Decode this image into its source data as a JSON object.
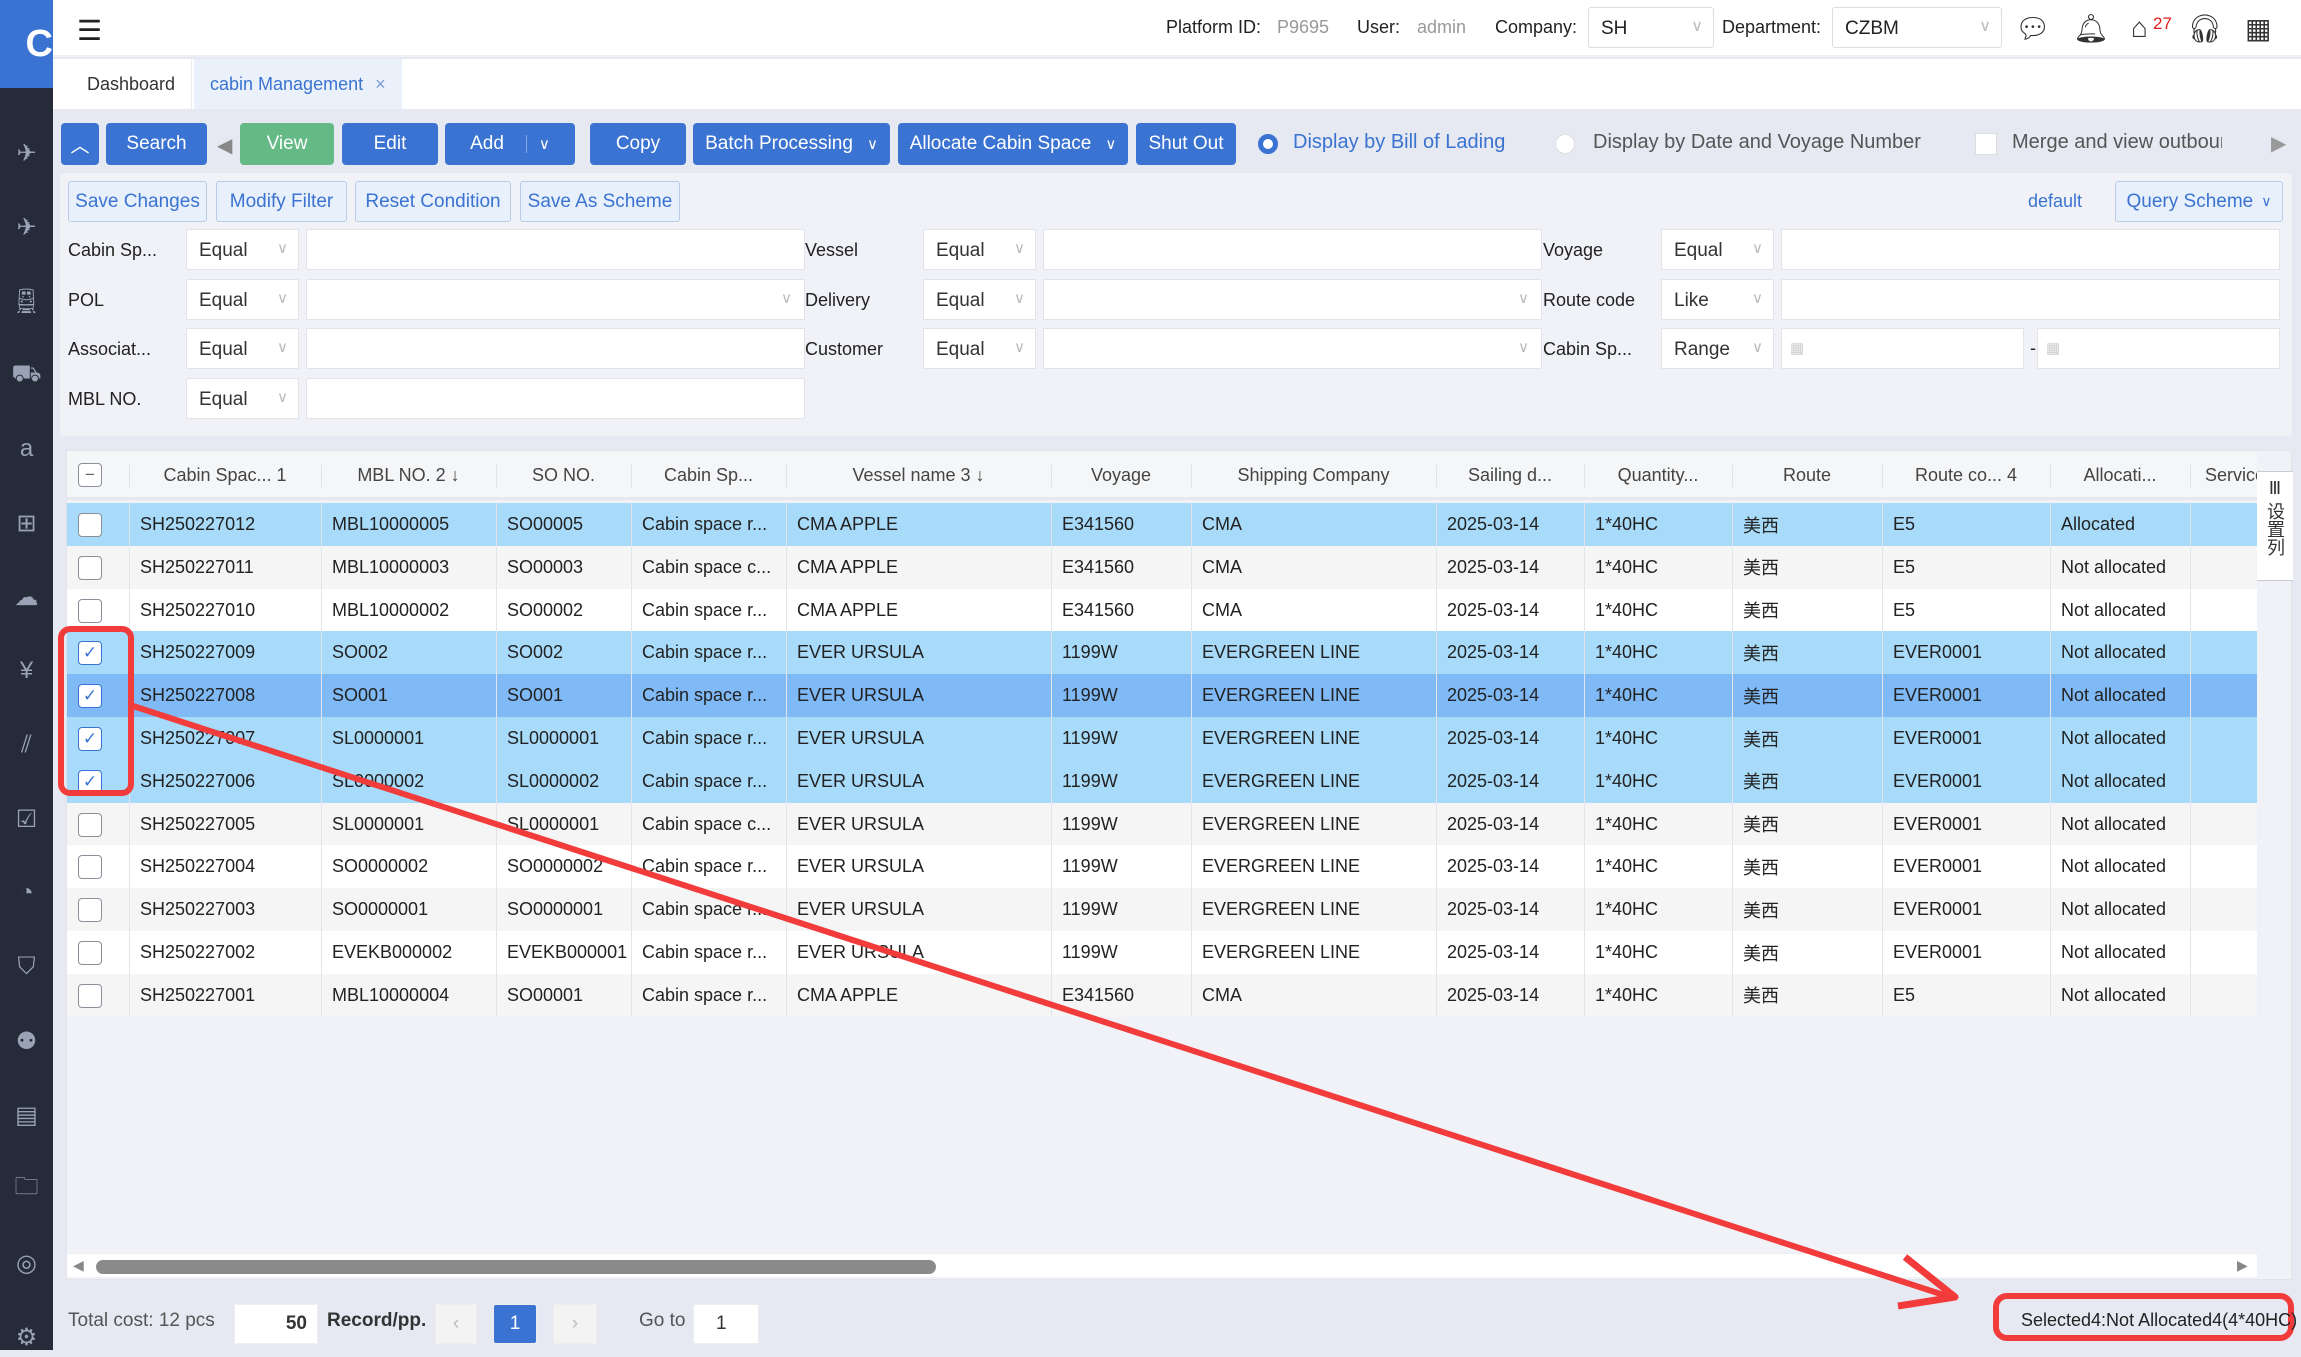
{
  "sidebar": {
    "logo": "C",
    "icons": [
      "flight-export-icon",
      "flight-import-icon",
      "rail-icon",
      "truck-icon",
      "amazon-icon",
      "calculator-icon",
      "cloud-upload-icon",
      "finance-icon",
      "chart-icon",
      "checklist-icon",
      "pie-chart-icon",
      "shield-icon",
      "robot-icon",
      "report-icon",
      "folder-icon",
      "webcam-icon",
      "settings-icon"
    ]
  },
  "header": {
    "platform_label": "Platform ID:",
    "platform_id": "P9695",
    "user_label": "User:",
    "user": "admin",
    "company_label": "Company:",
    "company": "SH",
    "department_label": "Department:",
    "department": "CZBM",
    "notif_count": "27"
  },
  "tabs": [
    {
      "label": "Dashboard"
    },
    {
      "label": "cabin Management",
      "close": "×"
    }
  ],
  "toolbar": {
    "search": "Search",
    "view": "View",
    "edit": "Edit",
    "add": "Add",
    "copy": "Copy",
    "batch": "Batch Processing",
    "allocate": "Allocate Cabin Space",
    "shutout": "Shut Out",
    "opt1": "Display by Bill of Lading",
    "opt2": "Display by Date and Voyage Number",
    "opt3": "Merge and view outbound b"
  },
  "filters": {
    "save_changes": "Save Changes",
    "modify_filter": "Modify Filter",
    "reset": "Reset Condition",
    "save_scheme": "Save As Scheme",
    "default": "default",
    "query_scheme": "Query Scheme",
    "fields": [
      {
        "label": "Cabin Sp...",
        "op": "Equal"
      },
      {
        "label": "Vessel",
        "op": "Equal"
      },
      {
        "label": "Voyage",
        "op": "Equal"
      },
      {
        "label": "POL",
        "op": "Equal"
      },
      {
        "label": "Delivery",
        "op": "Equal"
      },
      {
        "label": "Route code",
        "op": "Like"
      },
      {
        "label": "Associat...",
        "op": "Equal"
      },
      {
        "label": "Customer",
        "op": "Equal"
      },
      {
        "label": "Cabin Sp...",
        "op": "Range"
      },
      {
        "label": "MBL NO.",
        "op": "Equal"
      }
    ],
    "range_sep": "-"
  },
  "table": {
    "columns": [
      "Cabin Spac...  1",
      "MBL NO.  2 ↓",
      "SO NO.",
      "Cabin Sp...",
      "Vessel name  3 ↓",
      "Voyage",
      "Shipping Company",
      "Sailing d...",
      "Quantity...",
      "Route",
      "Route co...  4",
      "Allocati...",
      "Service"
    ],
    "column_settings": "设置列",
    "rows": [
      {
        "checked": false,
        "state": "sel",
        "cells": [
          "SH250227012",
          "MBL10000005",
          "SO00005",
          "Cabin space r...",
          "CMA APPLE",
          "E341560",
          "CMA",
          "2025-03-14",
          "1*40HC",
          "美西",
          "E5",
          "Allocated",
          ""
        ]
      },
      {
        "checked": false,
        "state": "odd",
        "cells": [
          "SH250227011",
          "MBL10000003",
          "SO00003",
          "Cabin space c...",
          "CMA APPLE",
          "E341560",
          "CMA",
          "2025-03-14",
          "1*40HC",
          "美西",
          "E5",
          "Not allocated",
          ""
        ]
      },
      {
        "checked": false,
        "state": "even",
        "cells": [
          "SH250227010",
          "MBL10000002",
          "SO00002",
          "Cabin space r...",
          "CMA APPLE",
          "E341560",
          "CMA",
          "2025-03-14",
          "1*40HC",
          "美西",
          "E5",
          "Not allocated",
          ""
        ]
      },
      {
        "checked": true,
        "state": "sel",
        "cells": [
          "SH250227009",
          "SO002",
          "SO002",
          "Cabin space r...",
          "EVER URSULA",
          "1199W",
          "EVERGREEN LINE",
          "2025-03-14",
          "1*40HC",
          "美西",
          "EVER0001",
          "Not allocated",
          ""
        ]
      },
      {
        "checked": true,
        "state": "cur",
        "cells": [
          "SH250227008",
          "SO001",
          "SO001",
          "Cabin space r...",
          "EVER URSULA",
          "1199W",
          "EVERGREEN LINE",
          "2025-03-14",
          "1*40HC",
          "美西",
          "EVER0001",
          "Not allocated",
          ""
        ]
      },
      {
        "checked": true,
        "state": "sel",
        "cells": [
          "SH250227007",
          "SL0000001",
          "SL0000001",
          "Cabin space r...",
          "EVER URSULA",
          "1199W",
          "EVERGREEN LINE",
          "2025-03-14",
          "1*40HC",
          "美西",
          "EVER0001",
          "Not allocated",
          ""
        ]
      },
      {
        "checked": true,
        "state": "sel",
        "cells": [
          "SH250227006",
          "SL0000002",
          "SL0000002",
          "Cabin space r...",
          "EVER URSULA",
          "1199W",
          "EVERGREEN LINE",
          "2025-03-14",
          "1*40HC",
          "美西",
          "EVER0001",
          "Not allocated",
          ""
        ]
      },
      {
        "checked": false,
        "state": "odd",
        "cells": [
          "SH250227005",
          "SL0000001",
          "SL0000001",
          "Cabin space c...",
          "EVER URSULA",
          "1199W",
          "EVERGREEN LINE",
          "2025-03-14",
          "1*40HC",
          "美西",
          "EVER0001",
          "Not allocated",
          ""
        ]
      },
      {
        "checked": false,
        "state": "even",
        "cells": [
          "SH250227004",
          "SO0000002",
          "SO0000002",
          "Cabin space r...",
          "EVER URSULA",
          "1199W",
          "EVERGREEN LINE",
          "2025-03-14",
          "1*40HC",
          "美西",
          "EVER0001",
          "Not allocated",
          ""
        ]
      },
      {
        "checked": false,
        "state": "odd",
        "cells": [
          "SH250227003",
          "SO0000001",
          "SO0000001",
          "Cabin space r...",
          "EVER URSULA",
          "1199W",
          "EVERGREEN LINE",
          "2025-03-14",
          "1*40HC",
          "美西",
          "EVER0001",
          "Not allocated",
          ""
        ]
      },
      {
        "checked": false,
        "state": "even",
        "cells": [
          "SH250227002",
          "EVEKB000002",
          "EVEKB000001",
          "Cabin space r...",
          "EVER URSULA",
          "1199W",
          "EVERGREEN LINE",
          "2025-03-14",
          "1*40HC",
          "美西",
          "EVER0001",
          "Not allocated",
          ""
        ]
      },
      {
        "checked": false,
        "state": "odd",
        "cells": [
          "SH250227001",
          "MBL10000004",
          "SO00001",
          "Cabin space r...",
          "CMA APPLE",
          "E341560",
          "CMA",
          "2025-03-14",
          "1*40HC",
          "美西",
          "E5",
          "Not allocated",
          ""
        ]
      }
    ]
  },
  "pager": {
    "total": "Total cost: 12 pcs",
    "page_size": "50",
    "per_page_label": "Record/pp.",
    "current_page": "1",
    "goto_label": "Go to",
    "goto_value": "1",
    "prev": "‹",
    "next": "›"
  },
  "status": {
    "selection_summary": "Selected4:Not Allocated4(4*40HC)"
  }
}
